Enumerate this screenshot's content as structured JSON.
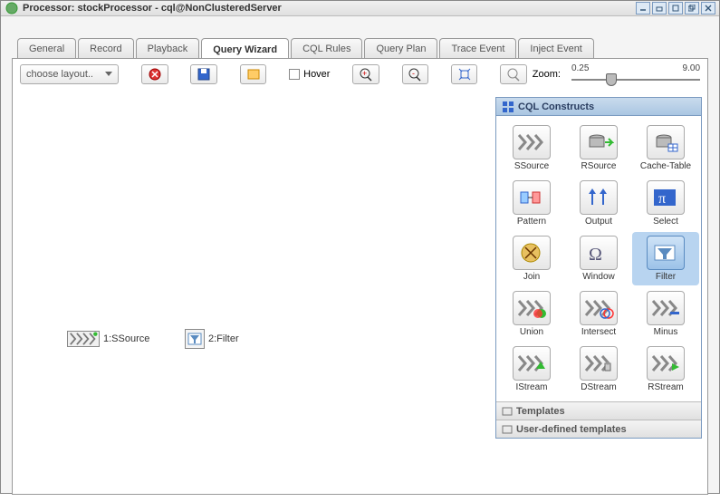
{
  "title": "Processor: stockProcessor - cql@NonClusteredServer",
  "tabs": [
    "General",
    "Record",
    "Playback",
    "Query Wizard",
    "CQL Rules",
    "Query Plan",
    "Trace Event",
    "Inject Event"
  ],
  "active_tab": "Query Wizard",
  "toolbar": {
    "layout_label": "choose layout..",
    "hover_label": "Hover",
    "zoom_label": "Zoom:",
    "zoom_min": "0.25",
    "zoom_max": "9.00"
  },
  "canvas_nodes": [
    {
      "id": "n1",
      "label": "1:SSource",
      "kind": "ssource"
    },
    {
      "id": "n2",
      "label": "2:Filter",
      "kind": "filter"
    }
  ],
  "palette": {
    "title": "CQL Constructs",
    "accordion1": "Templates",
    "accordion2": "User-defined templates",
    "items": [
      {
        "label": "SSource",
        "icon": "chevrons"
      },
      {
        "label": "RSource",
        "icon": "dbarrow"
      },
      {
        "label": "Cache-Table",
        "icon": "dbgrid"
      },
      {
        "label": "Pattern",
        "icon": "pattern"
      },
      {
        "label": "Output",
        "icon": "output"
      },
      {
        "label": "Select",
        "icon": "pi"
      },
      {
        "label": "Join",
        "icon": "join"
      },
      {
        "label": "Window",
        "icon": "omega"
      },
      {
        "label": "Filter",
        "icon": "filter",
        "selected": true
      },
      {
        "label": "Union",
        "icon": "chev-union"
      },
      {
        "label": "Intersect",
        "icon": "chev-intersect"
      },
      {
        "label": "Minus",
        "icon": "chev-minus"
      },
      {
        "label": "IStream",
        "icon": "chev-i"
      },
      {
        "label": "DStream",
        "icon": "chev-d"
      },
      {
        "label": "RStream",
        "icon": "chev-r"
      }
    ]
  }
}
